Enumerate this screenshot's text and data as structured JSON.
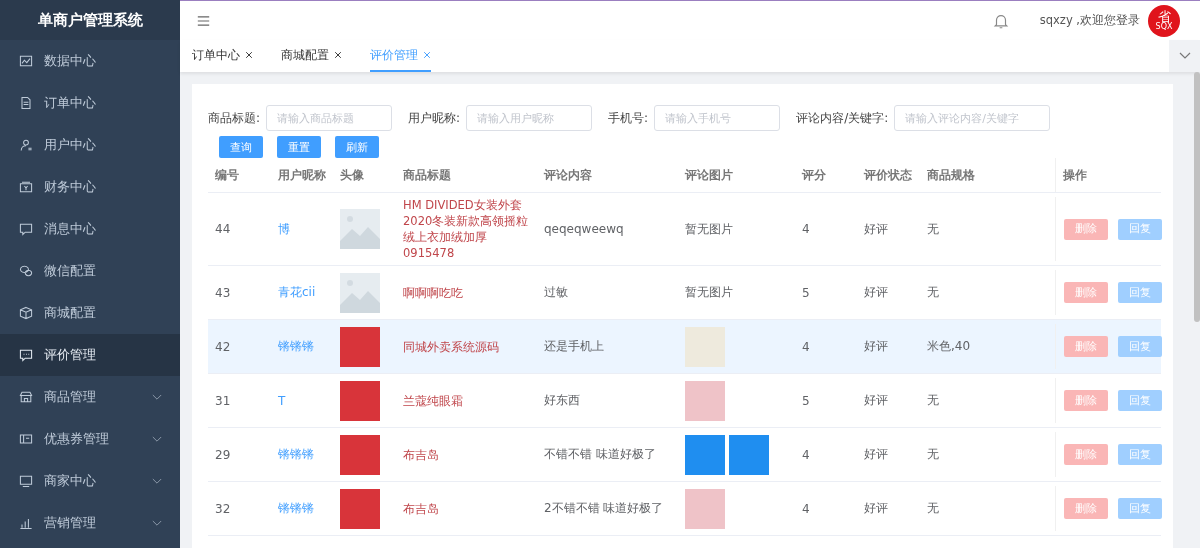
{
  "sidebar": {
    "title": "单商户管理系统",
    "items": [
      {
        "label": "数据中心",
        "kind": "link",
        "selected": false
      },
      {
        "label": "订单中心",
        "kind": "link",
        "selected": false
      },
      {
        "label": "用户中心",
        "kind": "link",
        "selected": false
      },
      {
        "label": "财务中心",
        "kind": "link",
        "selected": false
      },
      {
        "label": "消息中心",
        "kind": "link",
        "selected": false
      },
      {
        "label": "微信配置",
        "kind": "link",
        "selected": false
      },
      {
        "label": "商城配置",
        "kind": "link",
        "selected": false
      },
      {
        "label": "评价管理",
        "kind": "link",
        "selected": true
      },
      {
        "label": "商品管理",
        "kind": "group",
        "selected": false
      },
      {
        "label": "优惠券管理",
        "kind": "group",
        "selected": false
      },
      {
        "label": "商家中心",
        "kind": "group",
        "selected": false
      },
      {
        "label": "营销管理",
        "kind": "group",
        "selected": false
      }
    ]
  },
  "header": {
    "greeting": "sqxzy ,欢迎您登录",
    "logo": {
      "glyph": "省",
      "caption": "SQX"
    }
  },
  "tabs": [
    {
      "label": "订单中心",
      "selected": false
    },
    {
      "label": "商城配置",
      "selected": false
    },
    {
      "label": "评价管理",
      "selected": true
    }
  ],
  "filters": [
    {
      "label": "商品标题:",
      "placeholder": "请输入商品标题"
    },
    {
      "label": "用户昵称:",
      "placeholder": "请输入用户昵称"
    },
    {
      "label": "手机号:",
      "placeholder": "请输入手机号"
    },
    {
      "label": "评论内容/关键字:",
      "placeholder": "请输入评论内容/关键字"
    }
  ],
  "buttons": [
    "查询",
    "重置",
    "刷新"
  ],
  "table": {
    "columns": [
      "编号",
      "用户昵称",
      "头像",
      "商品标题",
      "评论内容",
      "评论图片",
      "评分",
      "评价状态",
      "商品规格",
      "操作"
    ],
    "rows": [
      {
        "id": "44",
        "nickname": "博",
        "avatar": {
          "kind": "default"
        },
        "title": "HM DIVIDED女装外套2020冬装新款高领摇粒绒上衣加绒加厚 0915478",
        "comment": "qeqeqweewq",
        "images": [],
        "no_image_text": "暂无图片",
        "rating": "4",
        "status": "好评",
        "spec": "无",
        "actions": [
          "删除",
          "回复"
        ],
        "selected": false
      },
      {
        "id": "43",
        "nickname": "青花cii",
        "avatar": {
          "kind": "default"
        },
        "title": "啊啊啊吃吃",
        "comment": "过敏",
        "images": [],
        "no_image_text": "暂无图片",
        "rating": "5",
        "status": "好评",
        "spec": "无",
        "actions": [
          "删除",
          "回复"
        ],
        "selected": false
      },
      {
        "id": "42",
        "nickname": "锵锵锵",
        "avatar": {
          "kind": "red"
        },
        "title": "同城外卖系统源码",
        "comment": "还是手机上",
        "images": [
          {
            "kind": "map"
          }
        ],
        "rating": "4",
        "status": "好评",
        "spec": "米色,40",
        "actions": [
          "删除",
          "回复"
        ],
        "selected": true
      },
      {
        "id": "31",
        "nickname": "T",
        "avatar": {
          "kind": "red"
        },
        "title": "兰蔻纯眼霜",
        "comment": "好东西",
        "images": [
          {
            "kind": "pink"
          }
        ],
        "rating": "5",
        "status": "好评",
        "spec": "无",
        "actions": [
          "删除",
          "回复"
        ],
        "selected": false
      },
      {
        "id": "29",
        "nickname": "锵锵锵",
        "avatar": {
          "kind": "red"
        },
        "title": "布吉岛",
        "comment": "不错不错 味道好极了",
        "images": [
          {
            "kind": "blue"
          },
          {
            "kind": "blue"
          }
        ],
        "rating": "4",
        "status": "好评",
        "spec": "无",
        "actions": [
          "删除",
          "回复"
        ],
        "selected": false
      },
      {
        "id": "32",
        "nickname": "锵锵锵",
        "avatar": {
          "kind": "red"
        },
        "title": "布吉岛",
        "comment": "2不错不错 味道好极了",
        "images": [
          {
            "kind": "pink"
          }
        ],
        "rating": "4",
        "status": "好评",
        "spec": "无",
        "actions": [
          "删除",
          "回复"
        ],
        "selected": false
      }
    ]
  }
}
